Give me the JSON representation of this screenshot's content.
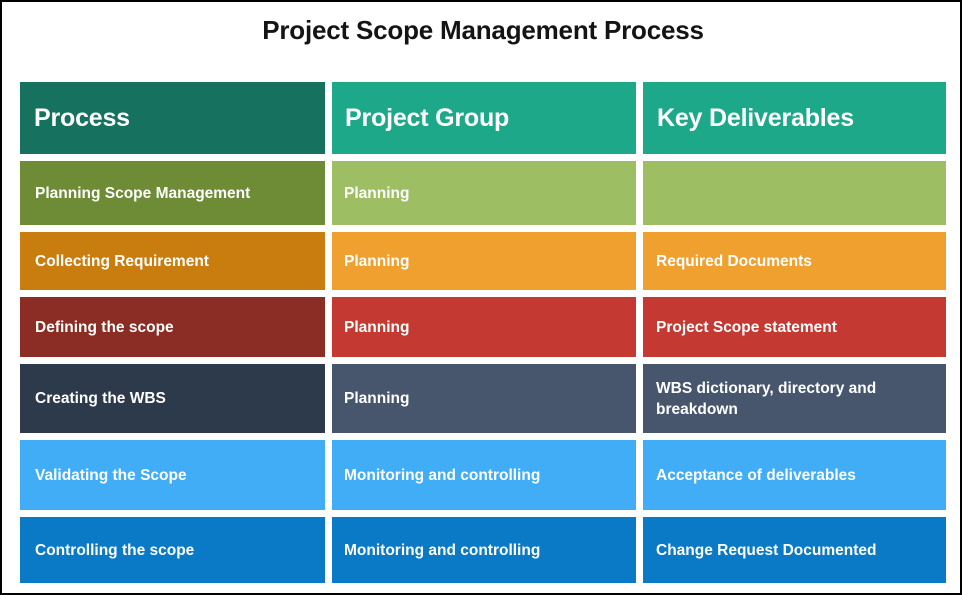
{
  "title": "Project Scope Management Process",
  "theme": {
    "page_background": "#ffffff",
    "page_border": "#000000",
    "title_color": "#141414",
    "cell_text_color": "#ffffff"
  },
  "table": {
    "headers": [
      {
        "label": "Process",
        "color": "#16725F"
      },
      {
        "label": "Project Group",
        "color": "#1DA88A"
      },
      {
        "label": "Key Deliverables",
        "color": "#1DA88A"
      }
    ],
    "rows": [
      {
        "name": "planning-scope-management",
        "process": "Planning Scope Management",
        "project_group": "Planning",
        "key_deliverables": "",
        "color_primary": "#6E8B36",
        "color_secondary": "#9DBE62"
      },
      {
        "name": "collecting-requirement",
        "process": "Collecting Requirement",
        "project_group": "Planning",
        "key_deliverables": "Required Documents",
        "color_primary": "#C87D0E",
        "color_secondary": "#F0A02E"
      },
      {
        "name": "defining-the-scope",
        "process": "Defining the scope",
        "project_group": "Planning",
        "key_deliverables": "Project Scope statement",
        "color_primary": "#8B2D24",
        "color_secondary": "#C43A33"
      },
      {
        "name": "creating-the-wbs",
        "process": "Creating the WBS",
        "project_group": "Planning",
        "key_deliverables": "WBS dictionary, directory and breakdown",
        "color_primary": "#2C3A4C",
        "color_secondary": "#47566D"
      },
      {
        "name": "validating-the-scope",
        "process": "Validating the Scope",
        "project_group": "Monitoring and controlling",
        "key_deliverables": "Acceptance of deliverables",
        "color_primary": "#41ADF7",
        "color_secondary": "#41ADF7"
      },
      {
        "name": "controlling-the-scope",
        "process": "Controlling the scope",
        "project_group": "Monitoring and controlling",
        "key_deliverables": "Change Request Documented",
        "color_primary": "#0A79C6",
        "color_secondary": "#0A79C6"
      }
    ]
  }
}
